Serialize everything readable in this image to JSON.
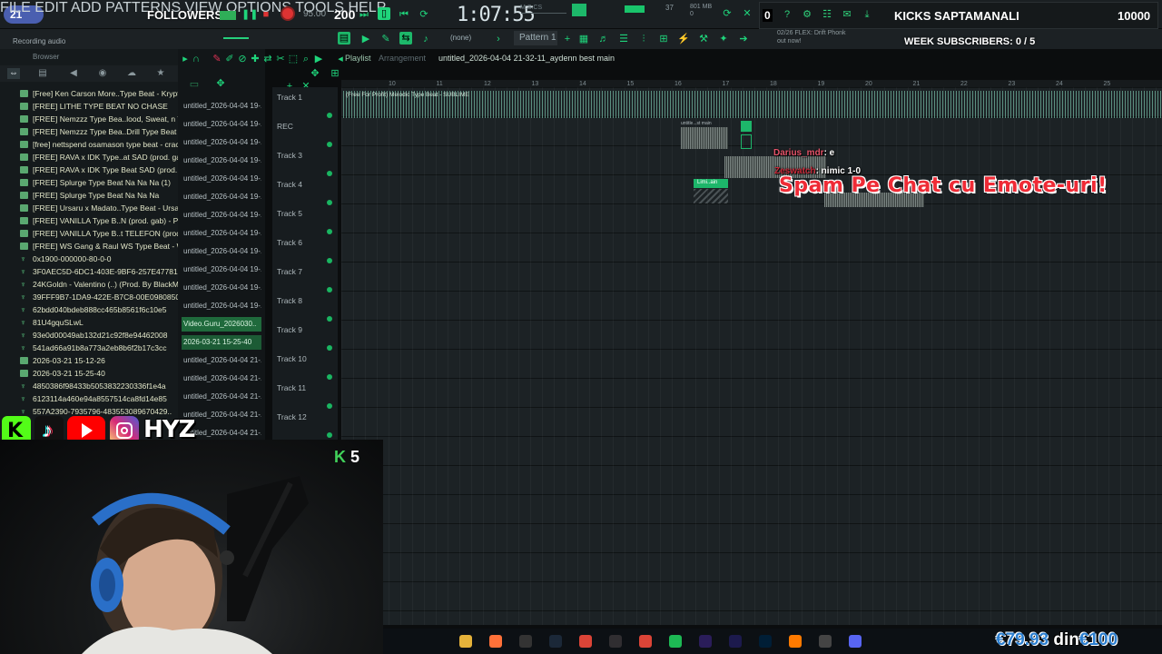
{
  "topbar": {
    "stream_badge": "21",
    "menu": "FILE  EDIT  ADD  PATTERNS  VIEW  OPTIONS  TOOLS  HELP",
    "followers_label": "FOLLOWERS",
    "followers_count": "200",
    "tempo": "95.00",
    "song_time": "1:07:55",
    "time_label": "M:S:CS",
    "cpu_counter": "37",
    "memory": "801 MB",
    "memory_sub": "0"
  },
  "toolbar2": {
    "recording_label": "Recording audio",
    "snap_value": "(none)",
    "pattern": "Pattern 1",
    "flex_info_1": "02/26  FLEX: Drift Phonk",
    "flex_info_2": "out now!"
  },
  "overlay": {
    "kicks_zero": "0",
    "kicks_title": "KICKS SAPTAMANALI",
    "kicks_value": "10000",
    "week_subscribers": "WEEK SUBSCRIBERS: 0 / 5",
    "k_count": "5",
    "hyz": "HYZ",
    "money_now": "€79.93",
    "money_din": "din",
    "money_goal": "€100"
  },
  "browser": {
    "title": "Browser",
    "items": [
      {
        "label": "[Free] Ken Carson More..Type Beat - Kryptonite",
        "icon": "audio-file-icon"
      },
      {
        "label": "[FREE] LITHE TYPE BEAT NO CHASE",
        "icon": "audio-file-icon"
      },
      {
        "label": "[FREE] Nemzzz Type Bea..lood, Sweat, n Tears'",
        "icon": "audio-file-icon"
      },
      {
        "label": "[FREE] Nemzzz Type Bea..Drill Type Beat 2024",
        "icon": "audio-file-icon"
      },
      {
        "label": "[free] nettspend osamason type beat - crack",
        "icon": "audio-file-icon"
      },
      {
        "label": "[FREE] RAVA x IDK Type..at SAD (prod. gab) (1)",
        "icon": "audio-file-icon"
      },
      {
        "label": "[FREE] RAVA x IDK Type Beat SAD (prod. gab)",
        "icon": "audio-file-icon"
      },
      {
        "label": "[FREE] Splurge Type Beat Na Na Na (1)",
        "icon": "audio-file-icon"
      },
      {
        "label": "[FREE] Splurge Type Beat Na Na Na",
        "icon": "audio-file-icon"
      },
      {
        "label": "[FREE] Ursaru x Madato..Type Beat - Ursarinho",
        "icon": "audio-file-icon"
      },
      {
        "label": "[FREE] VANILLA Type B..N (prod. gab) - Part_1",
        "icon": "audio-file-icon"
      },
      {
        "label": "[FREE] VANILLA Type B..t TELEFON (prod. gab)",
        "icon": "audio-file-icon"
      },
      {
        "label": "[FREE] WS Gang & Raul WS Type Beat - WS",
        "icon": "audio-file-icon"
      },
      {
        "label": "0x1900-000000-80-0-0",
        "icon": "waveform-icon"
      },
      {
        "label": "3F0AEC5D-6DC1-403E-9BF6-257E47781E86",
        "icon": "waveform-icon"
      },
      {
        "label": "24KGoldn - Valentino (..) (Prod. By BlackMayo)",
        "icon": "waveform-icon"
      },
      {
        "label": "39FFF9B7-1DA9-422E-B7C8-00E098085088",
        "icon": "waveform-icon"
      },
      {
        "label": "62bdd040bdeb888cc465b8561f6c10e5",
        "icon": "waveform-icon"
      },
      {
        "label": "81U4gquSLwL",
        "icon": "waveform-icon"
      },
      {
        "label": "93e0d00049ab132d21c92f8e94462008",
        "icon": "waveform-icon"
      },
      {
        "label": "541ad66a91b8a773a2eb8b6f2b17c3cc",
        "icon": "waveform-icon"
      },
      {
        "label": "2026-03-21 15-12-26",
        "icon": "audio-file-icon"
      },
      {
        "label": "2026-03-21 15-25-40",
        "icon": "audio-file-icon"
      },
      {
        "label": "4850386f98433b5053832230336f1e4a",
        "icon": "waveform-icon"
      },
      {
        "label": "6123114a460e94a8557514ca8fd14e85",
        "icon": "waveform-icon"
      },
      {
        "label": "557A2390-7935796-483553089670429..",
        "icon": "waveform-icon"
      }
    ]
  },
  "cliplist": {
    "items": [
      "untitled_2026-04-04 19-..",
      "untitled_2026-04-04 19-..",
      "untitled_2026-04-04 19-..",
      "untitled_2026-04-04 19-..",
      "untitled_2026-04-04 19-..",
      "untitled_2026-04-04 19-..",
      "untitled_2026-04-04 19-..",
      "untitled_2026-04-04 19-..",
      "untitled_2026-04-04 19-..",
      "untitled_2026-04-04 19-..",
      "untitled_2026-04-04 19-..",
      "untitled_2026-04-04 19-..",
      "Video.Guru_2026030..",
      "2026-03-21 15-25-40",
      "untitled_2026-04-04 21-..",
      "untitled_2026-04-04 21-..",
      "untitled_2026-04-04 21-..",
      "untitled_2026-04-04 21-..",
      "untitled_2026-04-04 21-.."
    ]
  },
  "playlist": {
    "title": "Playlist",
    "view": "Arrangement",
    "filename": "untitled_2026-04-04 21-32-11_aydenn best main",
    "clip_track1": "(Free For Profit) Melodic Type Beat - SUBLIME",
    "clip_small": "untitle...st main",
    "clip_green": "Limi..ain",
    "ruler": [
      "10",
      "11",
      "12",
      "13",
      "14",
      "15",
      "16",
      "17",
      "18",
      "19",
      "20",
      "21",
      "22",
      "23",
      "24",
      "25"
    ],
    "tracks": [
      "Track 1",
      "REC",
      "Track 3",
      "Track 4",
      "Track 5",
      "Track 6",
      "Track 7",
      "Track 8",
      "Track 9",
      "Track 10",
      "Track 11",
      "Track 12"
    ]
  },
  "chat": [
    {
      "user": "Darius_mdr",
      "message": ": e"
    },
    {
      "user": "Zeswatch",
      "message": ": nimic 1-0"
    }
  ],
  "alert": "Spam Pe Chat cu Emote-uri!",
  "taskbar": [
    "file-explorer-icon",
    "firefox-icon",
    "epic-games-icon",
    "steam-icon",
    "chrome-icon",
    "obs-icon",
    "chrome-icon",
    "spotify-icon",
    "after-effects-icon",
    "premiere-icon",
    "photoshop-icon",
    "fl-studio-icon",
    "app-icon",
    "discord-icon"
  ]
}
